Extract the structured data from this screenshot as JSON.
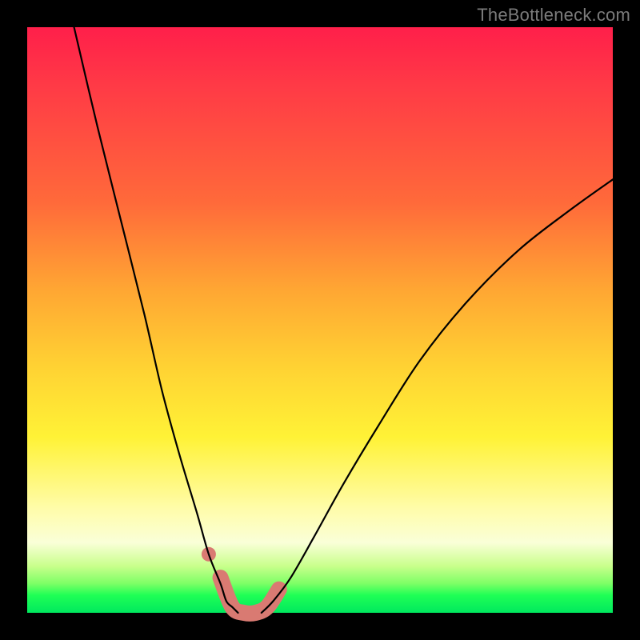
{
  "watermark": "TheBottleneck.com",
  "chart_data": {
    "type": "line",
    "title": "",
    "xlabel": "",
    "ylabel": "",
    "xlim": [
      0,
      100
    ],
    "ylim": [
      0,
      100
    ],
    "grid": false,
    "legend": false,
    "series": [
      {
        "name": "left-curve",
        "x": [
          8,
          12,
          16,
          20,
          23,
          26,
          29,
          31,
          33,
          34,
          35,
          36
        ],
        "y": [
          100,
          83,
          67,
          51,
          38,
          27,
          17,
          10,
          5,
          2,
          1,
          0
        ]
      },
      {
        "name": "right-curve",
        "x": [
          40,
          42,
          45,
          49,
          54,
          60,
          67,
          75,
          84,
          93,
          100
        ],
        "y": [
          0,
          2,
          6,
          13,
          22,
          32,
          43,
          53,
          62,
          69,
          74
        ]
      },
      {
        "name": "optimal-band",
        "x": [
          33,
          35,
          37,
          39,
          41,
          43
        ],
        "y": [
          6,
          1,
          0,
          0,
          1,
          4
        ]
      }
    ],
    "marker": {
      "name": "dot",
      "x": 31,
      "y": 10
    },
    "colors": {
      "curve": "#000000",
      "band": "#d97a72",
      "dot": "#d97a72"
    }
  }
}
